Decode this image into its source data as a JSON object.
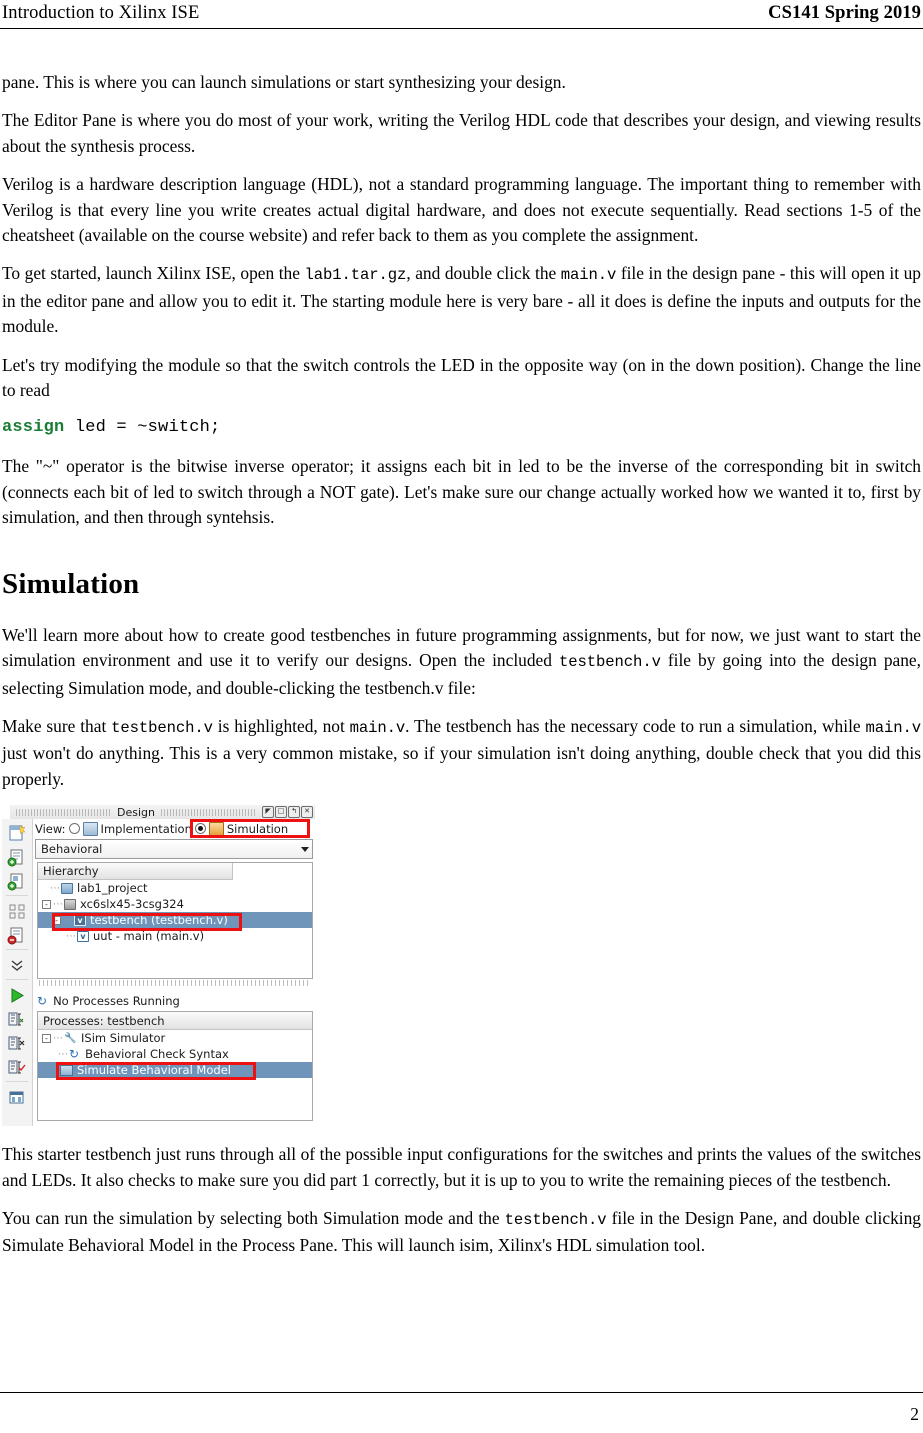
{
  "header": {
    "left": "Introduction to Xilinx ISE",
    "right": "CS141 Spring 2019"
  },
  "body": {
    "p1": "pane. This is where you can launch simulations or start synthesizing your design.",
    "p2": "The Editor Pane is where you do most of your work, writing the Verilog HDL code that describes your design, and viewing results about the synthesis process.",
    "p3": "Verilog is a hardware description language (HDL), not a standard programming language. The important thing to remember with Verilog is that every line you write creates actual digital hardware, and does not execute sequentially. Read sections 1-5 of the cheatsheet (available on the course website) and refer back to them as you complete the assignment.",
    "p4a": "To get started, launch Xilinx ISE, open the ",
    "p4_code1": "lab1.tar.gz",
    "p4b": ", and double click the ",
    "p4_code2": "main.v",
    "p4c": " file in the design pane - this will open it up in the editor pane and allow you to edit it. The starting module here is very bare - all it does is define the inputs and outputs for the module.",
    "p5": "Let's try modifying the module so that the switch controls the LED in the opposite way (on in the down position). Change the line to read",
    "code_keyword": "assign",
    "code_rest": " led = ~switch;",
    "p6": "The \"~\" operator is the bitwise inverse operator; it assigns each bit in led to be the inverse of the corresponding bit in switch (connects each bit of led to switch through a NOT gate). Let's make sure our change actually worked how we wanted it to, first by simulation, and then through syntehsis.",
    "section_title": "Simulation",
    "p7a": "We'll learn more about how to create good testbenches in future programming assignments, but for now, we just want to start the simulation environment and use it to verify our designs. Open the included ",
    "p7_code": "testbench.v",
    "p7b": " file by going into the design pane, selecting Simulation mode, and double-clicking the testbench.v file:",
    "p8a": "Make sure that ",
    "p8_code1": "testbench.v",
    "p8b": " is highlighted, not ",
    "p8_code2": "main.v",
    "p8c": ". The testbench has the necessary code to run a simulation, while ",
    "p8_code3": "main.v",
    "p8d": " just won't do anything. This is a very common mistake, so if your simulation isn't doing anything, double check that you did this properly.",
    "p9": "This starter testbench just runs through all of the possible input configurations for the switches and prints the values of the switches and LEDs. It also checks to make sure you did part 1 correctly, but it is up to you to write the remaining pieces of the testbench.",
    "p10a": "You can run the simulation by selecting both Simulation mode and the ",
    "p10_code": "testbench.v",
    "p10b": " file in the Design Pane, and double clicking Simulate Behavioral Model in the Process Pane. This will launch isim, Xilinx's HDL simulation tool."
  },
  "screenshot": {
    "title": "Design",
    "window_buttons": [
      "◤",
      "□",
      "↰",
      "✕"
    ],
    "view_row": {
      "label": "View:",
      "implementation_label": "Implementation",
      "implementation_selected": false,
      "simulation_label": "Simulation",
      "simulation_selected": true
    },
    "combo": {
      "value": "Behavioral"
    },
    "hierarchy": {
      "header": "Hierarchy",
      "rows": [
        {
          "label": "lab1_project",
          "indent": 10,
          "icon": "project-icon",
          "twisty": "",
          "selected": false
        },
        {
          "label": "xc6slx45-3csg324",
          "indent": 2,
          "icon": "device-icon",
          "twisty": "-",
          "selected": false
        },
        {
          "label": "testbench (testbench.v)",
          "indent": 12,
          "icon": "verilog-icon",
          "twisty": "-",
          "selected": true
        },
        {
          "label": "uut - main (main.v)",
          "indent": 26,
          "icon": "verilog-icon",
          "twisty": "",
          "selected": false
        }
      ]
    },
    "no_processes_running": "No Processes Running",
    "processes": {
      "header": "Processes: testbench",
      "rows": [
        {
          "label": "ISim Simulator",
          "indent": 4,
          "icon": "wrench-icon",
          "twisty": "-",
          "selected": false
        },
        {
          "label": "Behavioral Check Syntax",
          "indent": 28,
          "icon": "refresh-icon",
          "twisty": "",
          "selected": false
        },
        {
          "label": "Simulate Behavioral Model",
          "indent": 28,
          "icon": "isim-icon",
          "twisty": "",
          "selected": true
        }
      ]
    },
    "highlight_color": "#ee1111"
  },
  "footer": {
    "page_number": "2"
  }
}
